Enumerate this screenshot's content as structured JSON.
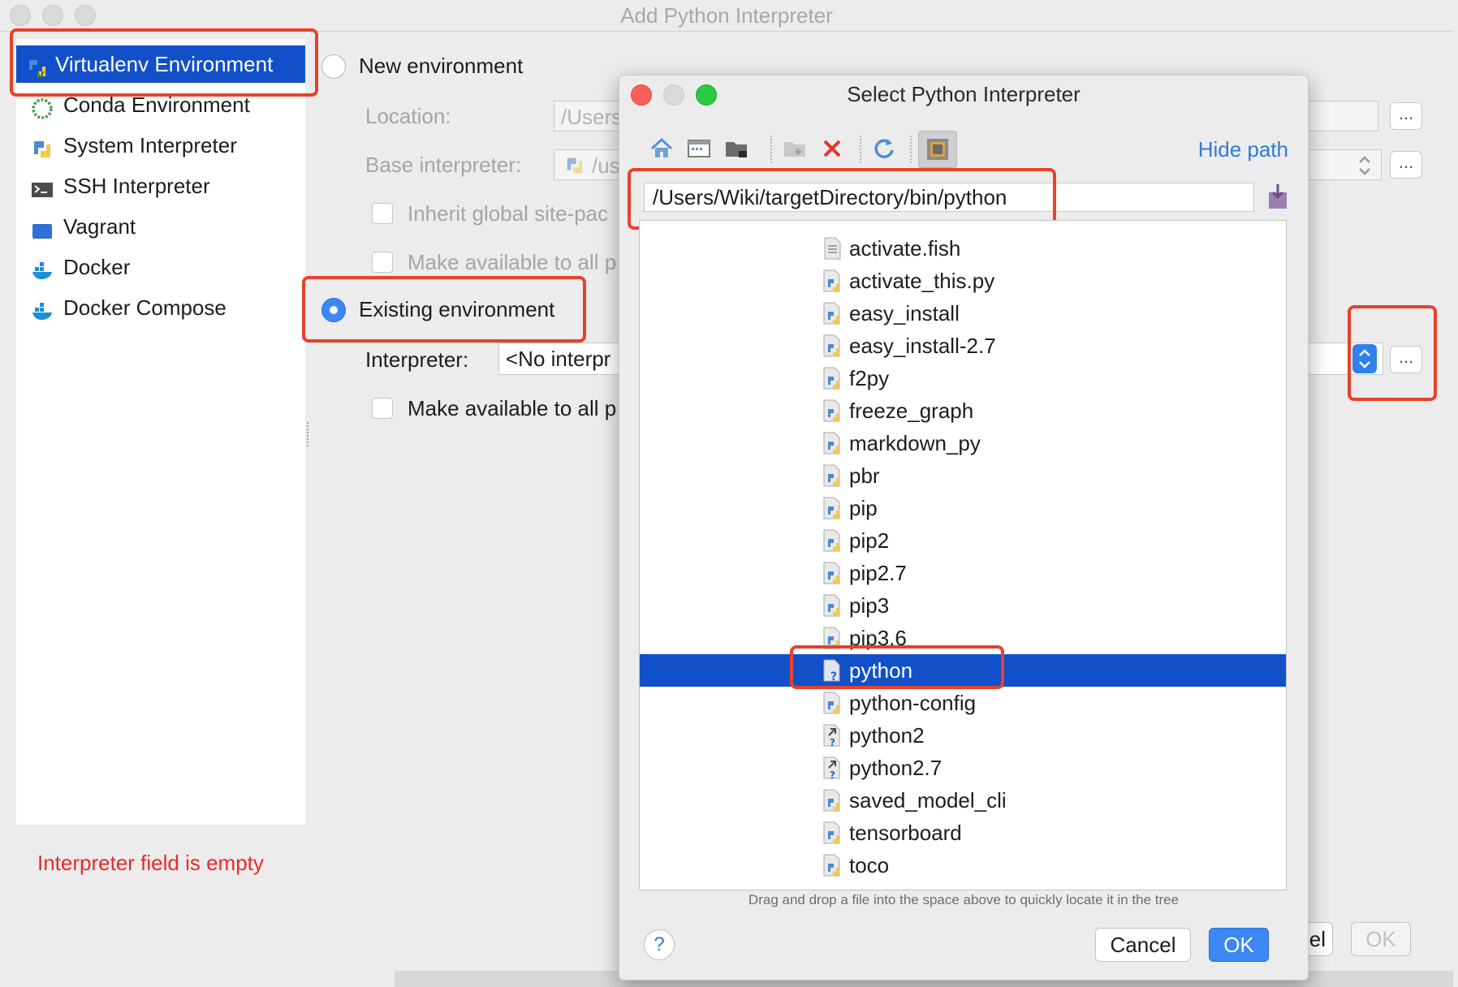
{
  "window": {
    "title": "Add Python Interpreter"
  },
  "sidebar": {
    "items": [
      {
        "label": "Virtualenv Environment",
        "icon": "virtualenv-icon"
      },
      {
        "label": "Conda Environment",
        "icon": "conda-icon"
      },
      {
        "label": "System Interpreter",
        "icon": "python-icon"
      },
      {
        "label": "SSH Interpreter",
        "icon": "terminal-icon"
      },
      {
        "label": "Vagrant",
        "icon": "vagrant-icon"
      },
      {
        "label": "Docker",
        "icon": "docker-icon"
      },
      {
        "label": "Docker Compose",
        "icon": "docker-compose-icon"
      }
    ],
    "selected": "Virtualenv Environment"
  },
  "form": {
    "new_env_label": "New environment",
    "location_label": "Location:",
    "location_value": "/Users",
    "base_interpreter_label": "Base interpreter:",
    "base_interpreter_value": "/us",
    "inherit_label": "Inherit global site-pac",
    "make_available_label_1": "Make available to all p",
    "existing_env_label": "Existing environment",
    "interpreter_label": "Interpreter:",
    "interpreter_value": "<No interpr",
    "make_available_label_2": "Make available to all p",
    "browse_label": "..."
  },
  "error_text": "Interpreter field is empty",
  "main_buttons": {
    "cancel_label": "el",
    "ok_label": "OK"
  },
  "dialog": {
    "title": "Select Python Interpreter",
    "hide_path_label": "Hide path",
    "path_value": "/Users/Wiki/targetDirectory/bin/python",
    "files": [
      {
        "name": "activate.fish",
        "icon": "text-file-icon"
      },
      {
        "name": "activate_this.py",
        "icon": "python-file-icon"
      },
      {
        "name": "easy_install",
        "icon": "python-file-icon"
      },
      {
        "name": "easy_install-2.7",
        "icon": "python-file-icon"
      },
      {
        "name": "f2py",
        "icon": "python-file-icon"
      },
      {
        "name": "freeze_graph",
        "icon": "python-file-icon"
      },
      {
        "name": "markdown_py",
        "icon": "python-file-icon"
      },
      {
        "name": "pbr",
        "icon": "python-file-icon"
      },
      {
        "name": "pip",
        "icon": "python-file-icon"
      },
      {
        "name": "pip2",
        "icon": "python-file-icon"
      },
      {
        "name": "pip2.7",
        "icon": "python-file-icon"
      },
      {
        "name": "pip3",
        "icon": "python-file-icon"
      },
      {
        "name": "pip3.6",
        "icon": "python-file-icon"
      },
      {
        "name": "python",
        "icon": "unknown-file-icon"
      },
      {
        "name": "python-config",
        "icon": "python-file-icon"
      },
      {
        "name": "python2",
        "icon": "symlink-file-icon"
      },
      {
        "name": "python2.7",
        "icon": "symlink-file-icon"
      },
      {
        "name": "saved_model_cli",
        "icon": "python-file-icon"
      },
      {
        "name": "tensorboard",
        "icon": "python-file-icon"
      },
      {
        "name": "toco",
        "icon": "python-file-icon"
      }
    ],
    "selected_file": "python",
    "hint": "Drag and drop a file into the space above to quickly locate it in the tree",
    "help_label": "?",
    "cancel_label": "Cancel",
    "ok_label": "OK"
  },
  "colors": {
    "selection": "#1150c9",
    "highlight_box": "#e8412c",
    "error": "#e82a2a",
    "link": "#2e7cd6"
  }
}
